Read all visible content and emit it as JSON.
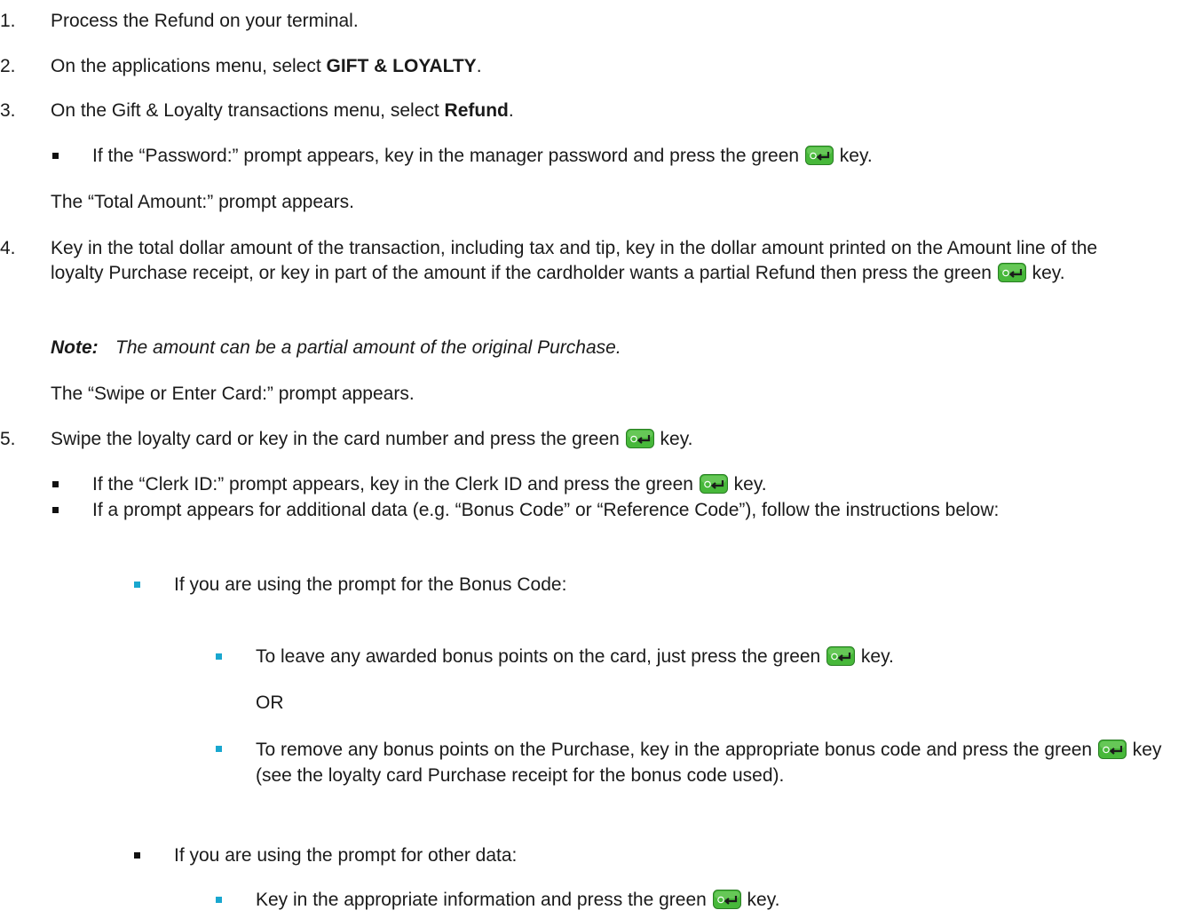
{
  "steps": [
    {
      "num": "1.",
      "text": "Process the Refund on your terminal."
    },
    {
      "num": "2.",
      "pre": "On the applications menu, select ",
      "bold": "GIFT & LOYALTY",
      "post": "."
    },
    {
      "num": "3.",
      "pre": "On the Gift & Loyalty transactions menu, select ",
      "bold": "Refund",
      "post": "."
    },
    {
      "num": "4.",
      "text": "Key in the total dollar amount of the transaction, including tax and tip, key in the dollar amount printed on the Amount line of the loyalty Purchase receipt, or key in part of the amount if the cardholder wants a partial Refund then press the green",
      "post": "key."
    },
    {
      "num": "5.",
      "pre": "Swipe the loyalty card or key in the card number and press the green",
      "post": "key."
    }
  ],
  "step3_bullet": {
    "pre": "If the “Password:” prompt appears, key in the manager password and press the green",
    "post": "key."
  },
  "step3_result": "The “Total Amount:” prompt appears.",
  "note": {
    "label": "Note:",
    "text": "The amount can be a partial amount of the original Purchase."
  },
  "step4_result": "The “Swipe or Enter Card:” prompt appears.",
  "step5_bullets": {
    "clerk": {
      "pre": "If the “Clerk ID:” prompt appears, key in the Clerk ID and press the green",
      "post": "key."
    },
    "additional": "If a prompt appears for additional data (e.g. “Bonus Code” or “Reference Code”), follow the instructions below:",
    "bonus_intro": "If you are using the prompt for the Bonus Code:",
    "leave": {
      "pre": "To leave any awarded bonus points on the card, just press the green",
      "post": "key."
    },
    "or": "OR",
    "remove": {
      "pre": "To remove any bonus points on the Purchase, key in the appropriate bonus code and press the green",
      "post": "key (see the loyalty card Purchase receipt for the bonus code used)."
    },
    "other_intro": "If you are using the prompt for other data:",
    "other": {
      "pre": "Key in the appropriate information and press the green",
      "post": "key."
    }
  },
  "icons": {
    "enter_key": "green-enter-key-icon"
  },
  "colors": {
    "key_green": "#47b83a",
    "sub_bullet": "#19a7cf"
  }
}
